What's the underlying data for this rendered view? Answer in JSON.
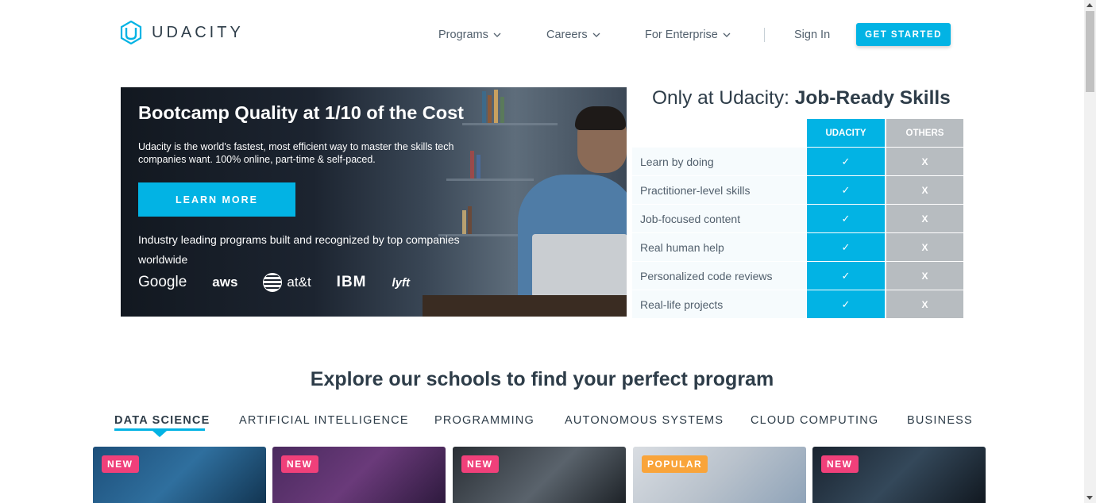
{
  "header": {
    "logo_text": "UDACITY",
    "nav": [
      {
        "label": "Programs",
        "has_dropdown": true
      },
      {
        "label": "Careers",
        "has_dropdown": true
      },
      {
        "label": "For Enterprise",
        "has_dropdown": true
      }
    ],
    "sign_in": "Sign In",
    "cta": "GET STARTED",
    "icons": [
      "udacity-logo-icon",
      "chevron-down-icon"
    ]
  },
  "hero": {
    "title": "Bootcamp Quality at 1/10 of the Cost",
    "subtitle": "Udacity is the world's fastest, most efficient way to master the skills tech companies want. 100% online, part-time & self-paced.",
    "button": "LEARN MORE",
    "tagline": "Industry leading programs built and recognized by top companies worldwide",
    "brands": [
      "Google",
      "aws",
      "at&t",
      "IBM",
      "lyft"
    ]
  },
  "comparison": {
    "title_prefix": "Only at Udacity: ",
    "title_bold": "Job-Ready Skills",
    "col_udacity": "UDACITY",
    "col_others": "OTHERS",
    "rows": [
      {
        "label": "Learn by doing",
        "udacity": "✓",
        "others": "X"
      },
      {
        "label": "Practitioner-level skills",
        "udacity": "✓",
        "others": "X"
      },
      {
        "label": "Job-focused content",
        "udacity": "✓",
        "others": "X"
      },
      {
        "label": "Real human help",
        "udacity": "✓",
        "others": "X"
      },
      {
        "label": "Personalized code reviews",
        "udacity": "✓",
        "others": "X"
      },
      {
        "label": "Real-life projects",
        "udacity": "✓",
        "others": "X"
      }
    ]
  },
  "explore": {
    "title": "Explore our schools to find your perfect program",
    "tabs": [
      "DATA SCIENCE",
      "ARTIFICIAL INTELLIGENCE",
      "PROGRAMMING",
      "AUTONOMOUS SYSTEMS",
      "CLOUD COMPUTING",
      "BUSINESS"
    ],
    "active_tab": "DATA SCIENCE",
    "cards": [
      {
        "badge": "NEW"
      },
      {
        "badge": "NEW"
      },
      {
        "badge": "NEW"
      },
      {
        "badge": "POPULAR"
      },
      {
        "badge": "NEW"
      }
    ]
  },
  "colors": {
    "accent": "#02b3e4",
    "badge_new": "#f0407a",
    "badge_popular": "#f9a43a",
    "others_col": "#b7bcc0",
    "text": "#2e3d49"
  }
}
